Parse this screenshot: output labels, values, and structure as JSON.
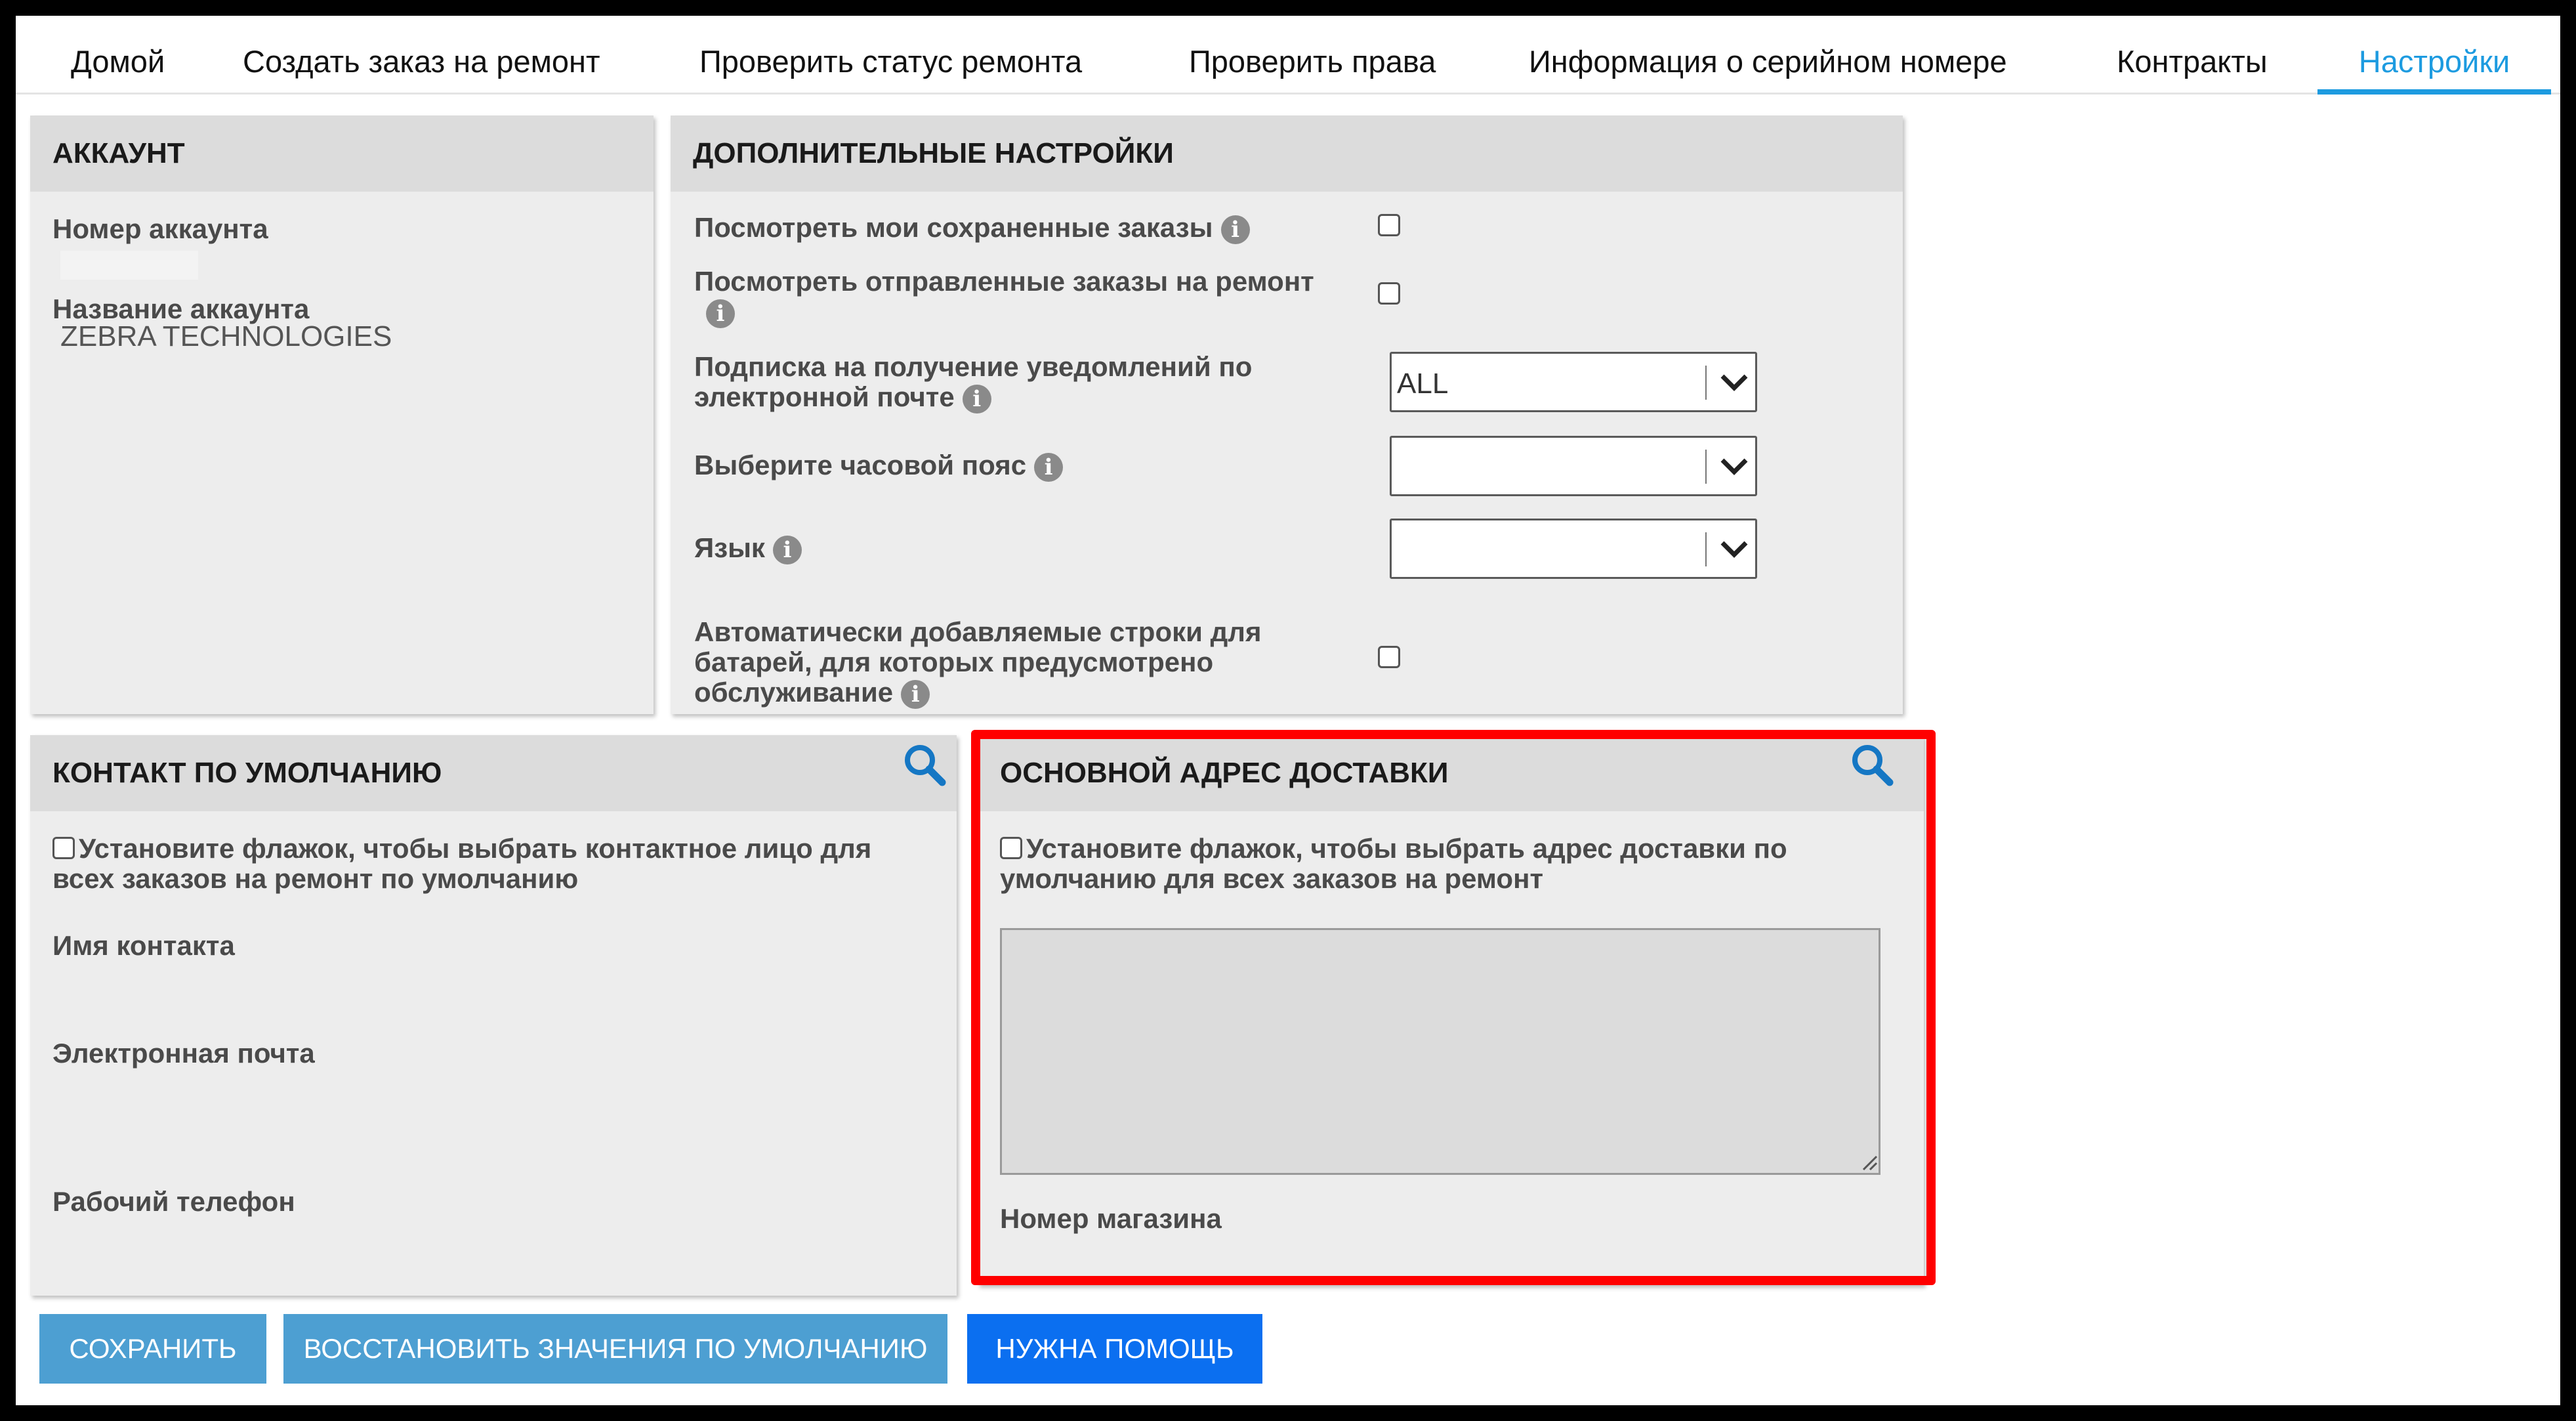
{
  "nav": {
    "items": [
      {
        "label": "Домой"
      },
      {
        "label": "Создать заказ на ремонт"
      },
      {
        "label": "Проверить статус ремонта"
      },
      {
        "label": "Проверить права"
      },
      {
        "label": "Информация о серийном номере"
      },
      {
        "label": "Контракты"
      },
      {
        "label": "Настройки",
        "active": true
      }
    ]
  },
  "account": {
    "header": "АККАУНТ",
    "number_label": "Номер аккаунта",
    "number_value": "",
    "name_label": "Название аккаунта",
    "name_value": "ZEBRA TECHNOLOGIES"
  },
  "additional": {
    "header": "ДОПОЛНИТЕЛЬНЫЕ НАСТРОЙКИ",
    "saved_orders_label": "Посмотреть мои сохраненные заказы",
    "sent_orders_label": "Посмотреть отправленные заказы на ремонт",
    "email_sub_label": "Подписка на получение уведомлений по электронной почте",
    "email_sub_value": "ALL",
    "timezone_label": "Выберите часовой пояс",
    "timezone_value": "",
    "language_label": "Язык",
    "language_value": "",
    "battery_label": "Автоматически добавляемые строки для батарей, для которых предусмотрено обслуживание"
  },
  "contact": {
    "header": "КОНТАКТ ПО УМОЛЧАНИЮ",
    "checkbox_label": "Установите флажок, чтобы выбрать контактное лицо для всех заказов на ремонт по умолчанию",
    "name_label": "Имя контакта",
    "email_label": "Электронная почта",
    "phone_label": "Рабочий телефон"
  },
  "shipping": {
    "header": "ОСНОВНОЙ АДРЕС ДОСТАВКИ",
    "checkbox_label": "Установите флажок, чтобы  выбрать адрес доставки по умолчанию для всех заказов на ремонт",
    "address_value": "",
    "store_label": "Номер магазина"
  },
  "buttons": {
    "save": "СОХРАНИТЬ",
    "restore": "ВОССТАНОВИТЬ ЗНАЧЕНИЯ ПО УМОЛЧАНИЮ",
    "help": "НУЖНА ПОМОЩЬ"
  },
  "colors": {
    "accent": "#1d9be0",
    "highlight": "#ff0000",
    "primary_button": "#0b6ff0",
    "secondary_button": "#4d9fd2",
    "panel": "#ededed",
    "panel_header": "#dcdcdc"
  },
  "icons": {
    "info": "info-icon",
    "search": "search-icon",
    "dropdown": "chevron-down-icon"
  }
}
